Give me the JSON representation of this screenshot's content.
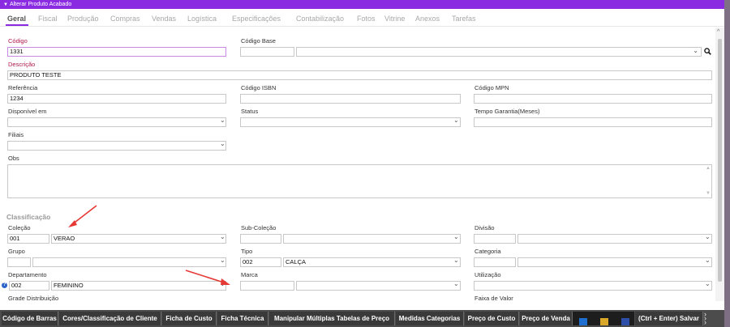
{
  "window": {
    "title": "Alterar Produto Acabado"
  },
  "tabs": [
    "Geral",
    "Fiscal",
    "Produção",
    "Compras",
    "Vendas",
    "Logística",
    "Especificações",
    "Contabilização",
    "Fotos",
    "Vitrine",
    "Anexos",
    "Tarefas"
  ],
  "form": {
    "codigo": {
      "label": "Código",
      "value": "1331"
    },
    "codigo_base": {
      "label": "Código Base",
      "value": ""
    },
    "descricao": {
      "label": "Descrição",
      "value": "PRODUTO TESTE"
    },
    "referencia": {
      "label": "Referência",
      "value": "1234"
    },
    "codigo_isbn": {
      "label": "Código ISBN",
      "value": ""
    },
    "codigo_mpn": {
      "label": "Código MPN",
      "value": ""
    },
    "disponivel_em": {
      "label": "Disponível em",
      "value": ""
    },
    "status": {
      "label": "Status",
      "value": ""
    },
    "tempo_garantia": {
      "label": "Tempo Garantia(Meses)",
      "value": ""
    },
    "filiais": {
      "label": "Filiais",
      "value": ""
    },
    "obs": {
      "label": "Obs",
      "value": ""
    }
  },
  "classificacao": {
    "title": "Classificação",
    "colecao": {
      "label": "Coleção",
      "code": "001",
      "value": "VERAO"
    },
    "sub_colecao": {
      "label": "Sub-Coleção",
      "code": "",
      "value": ""
    },
    "divisao": {
      "label": "Divisão",
      "code": "",
      "value": ""
    },
    "grupo": {
      "label": "Grupo",
      "code": "",
      "value": ""
    },
    "tipo": {
      "label": "Tipo",
      "code": "002",
      "value": "CALÇA"
    },
    "categoria": {
      "label": "Categoria",
      "code": "",
      "value": ""
    },
    "departamento": {
      "label": "Departamento",
      "code": "002",
      "value": "FEMININO"
    },
    "marca": {
      "label": "Marca",
      "code": "",
      "value": ""
    },
    "utilizacao": {
      "label": "Utilização",
      "value": ""
    },
    "grade_distribuicao": {
      "label": "Grade Distribuição"
    },
    "faixa_de_valor": {
      "label": "Faixa de Valor"
    }
  },
  "bottom_buttons": [
    "Código de Barras",
    "Cores/Classificação de Cliente",
    "Ficha de Custo",
    "Ficha Técnica",
    "Manipular Múltiplas Tabelas de Preço",
    "Medidas Categorias",
    "Preço de Custo",
    "Preço de Venda",
    "(Ctrl + Enter) Salvar"
  ],
  "icons": {
    "search": "search-icon",
    "help": "help-icon",
    "more": "more-icon"
  },
  "colors": {
    "accent": "#8a2be2",
    "required_label": "#b0174a",
    "annotation_arrow": "#e53935",
    "bottom_bar": "#3a3a3a"
  }
}
